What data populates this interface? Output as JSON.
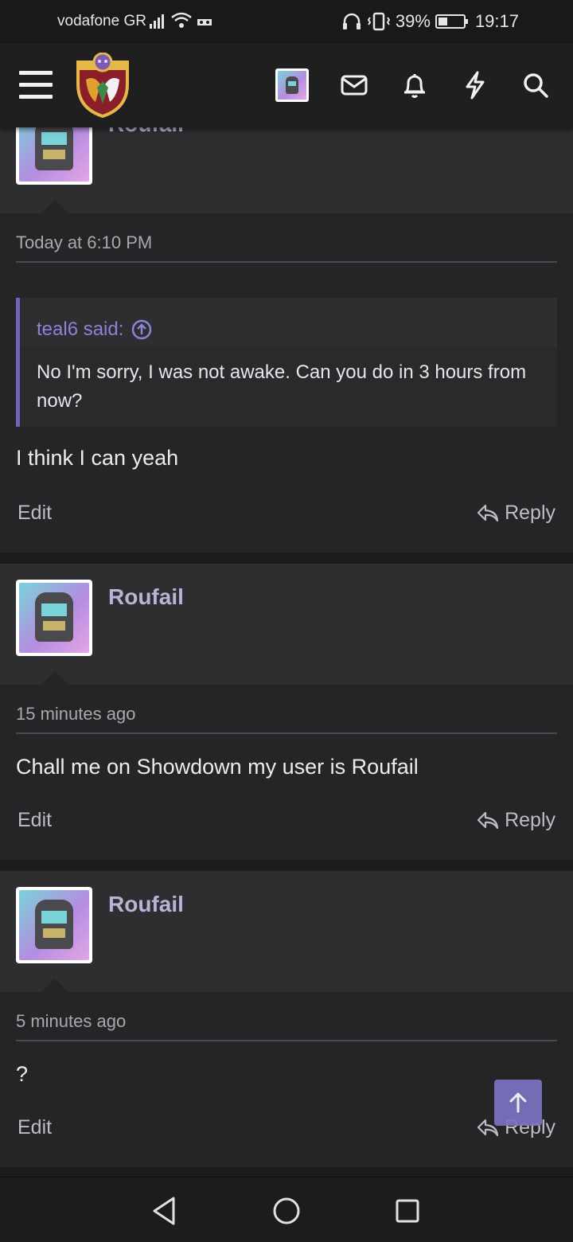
{
  "status_bar": {
    "carrier": "vodafone GR",
    "battery_percent": "39%",
    "time": "19:17"
  },
  "header": {
    "menu_icon": "hamburger-icon",
    "logo": "forum-logo",
    "icons": [
      "avatar-thumb",
      "mail-icon",
      "bell-icon",
      "bolt-icon",
      "search-icon"
    ]
  },
  "posts": [
    {
      "username": "Roufail",
      "timestamp": "Today at 6:10 PM",
      "quote": {
        "author_label": "teal6 said:",
        "text": "No I'm sorry, I was not awake. Can you do in 3 hours from now?"
      },
      "message": "I think I can yeah",
      "edit_label": "Edit",
      "reply_label": "Reply"
    },
    {
      "username": "Roufail",
      "timestamp": "15 minutes ago",
      "message": "Chall me on Showdown my user is Roufail",
      "edit_label": "Edit",
      "reply_label": "Reply"
    },
    {
      "username": "Roufail",
      "timestamp": "5 minutes ago",
      "message": "?",
      "edit_label": "Edit",
      "reply_label": "Reply"
    }
  ],
  "colors": {
    "accent": "#7b73c2",
    "username": "#b9b3d8",
    "quote_border": "#6b64b8"
  }
}
